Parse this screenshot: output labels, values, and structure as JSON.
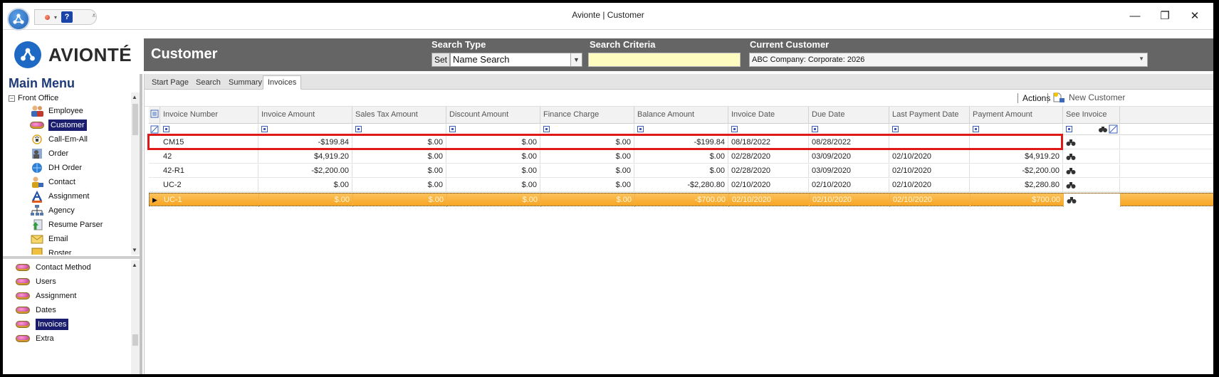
{
  "window": {
    "title": "Avionte | Customer",
    "minimize": "—",
    "restore": "❐",
    "close": "✕"
  },
  "brand": {
    "logo_text": "AVIONTÉ"
  },
  "header": {
    "page_title": "Customer",
    "search_type_label": "Search Type",
    "set_button": "Set",
    "search_type_value": "Name Search",
    "search_criteria_label": "Search Criteria",
    "search_criteria_value": "",
    "current_customer_label": "Current Customer",
    "current_customer_value": "ABC Company: Corporate: 2026"
  },
  "main_menu": {
    "title": "Main Menu",
    "root": "Front Office",
    "items": [
      {
        "label": "Employee",
        "icon": "employee-icon"
      },
      {
        "label": "Customer",
        "icon": "customer-icon",
        "selected": true
      },
      {
        "label": "Call-Em-All",
        "icon": "call-em-all-icon"
      },
      {
        "label": "Order",
        "icon": "order-icon"
      },
      {
        "label": "DH Order",
        "icon": "dh-order-icon"
      },
      {
        "label": "Contact",
        "icon": "contact-icon"
      },
      {
        "label": "Assignment",
        "icon": "assignment-icon"
      },
      {
        "label": "Agency",
        "icon": "agency-icon"
      },
      {
        "label": "Resume Parser",
        "icon": "resume-parser-icon"
      },
      {
        "label": "Email",
        "icon": "email-icon"
      },
      {
        "label": "Roster",
        "icon": "roster-icon"
      }
    ],
    "sub_items": [
      {
        "label": "Contact Method"
      },
      {
        "label": "Users"
      },
      {
        "label": "Assignment"
      },
      {
        "label": "Dates"
      },
      {
        "label": "Invoices",
        "selected": true
      },
      {
        "label": "Extra"
      }
    ]
  },
  "tabs": [
    "Start Page",
    "Search",
    "Summary",
    "Invoices"
  ],
  "active_tab": "Invoices",
  "toolbar": {
    "actions": "Actions",
    "new_customer": "New Customer"
  },
  "grid": {
    "columns": [
      "Invoice Number",
      "Invoice Amount",
      "Sales Tax Amount",
      "Discount Amount",
      "Finance Charge",
      "Balance Amount",
      "Invoice Date",
      "Due Date",
      "Last Payment Date",
      "Payment Amount",
      "See Invoice"
    ],
    "rows": [
      [
        "CM15",
        "-$199.84",
        "$.00",
        "$.00",
        "$.00",
        "-$199.84",
        "08/18/2022",
        "08/28/2022",
        "",
        ""
      ],
      [
        "42",
        "$4,919.20",
        "$.00",
        "$.00",
        "$.00",
        "$.00",
        "02/28/2020",
        "03/09/2020",
        "02/10/2020",
        "$4,919.20"
      ],
      [
        "42-R1",
        "-$2,200.00",
        "$.00",
        "$.00",
        "$.00",
        "$.00",
        "02/28/2020",
        "03/09/2020",
        "02/10/2020",
        "-$2,200.00"
      ],
      [
        "UC-2",
        "$.00",
        "$.00",
        "$.00",
        "$.00",
        "-$2,280.80",
        "02/10/2020",
        "02/10/2020",
        "02/10/2020",
        "$2,280.80"
      ],
      [
        "UC-1",
        "$.00",
        "$.00",
        "$.00",
        "$.00",
        "-$700.00",
        "02/10/2020",
        "02/10/2020",
        "02/10/2020",
        "$700.00"
      ]
    ],
    "active_row": 4,
    "highlighted_row": 0
  },
  "colors": {
    "header_band": "#656565",
    "selected_menu": "#1b1e6e",
    "active_row": "#f7a522",
    "highlight_box": "#e01818",
    "search_criteria_bg": "#fefcbf"
  }
}
